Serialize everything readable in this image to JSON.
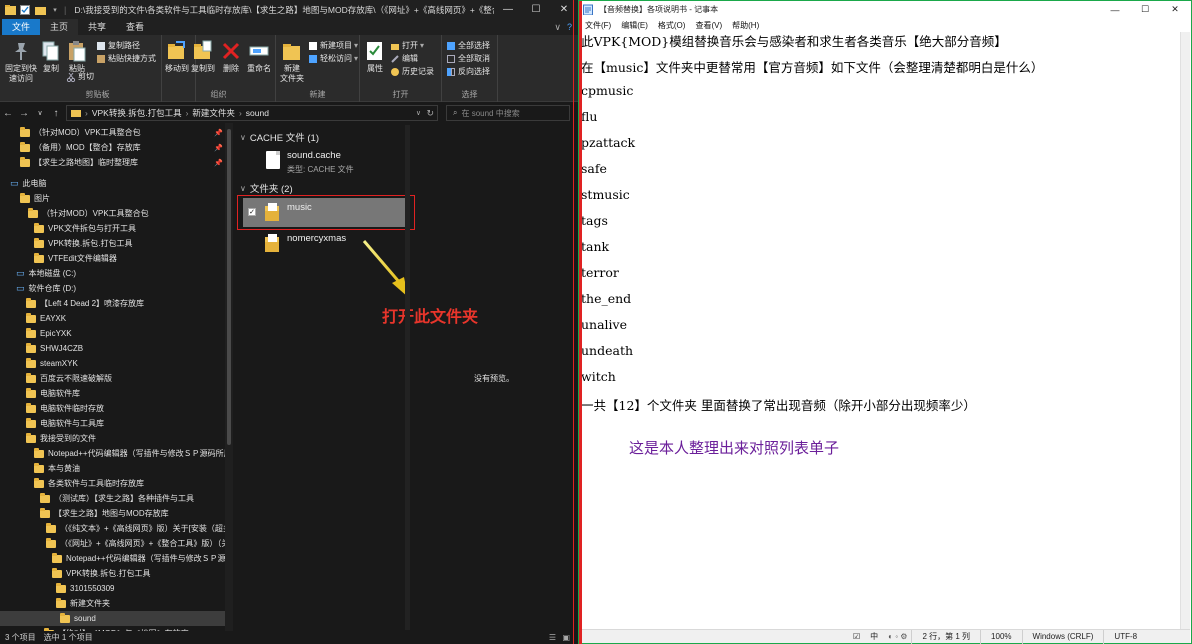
{
  "explorer": {
    "title": "D:\\我接受到的文件\\各类软件与工具临时存放库\\【求生之路】地图与MOD存放库\\（《网址》+《高线网页》+《整合工具》",
    "window_buttons": [
      "—",
      "☐",
      "✕"
    ],
    "tabs": [
      {
        "label": "文件"
      },
      {
        "label": "主页"
      },
      {
        "label": "共享"
      },
      {
        "label": "查看"
      }
    ],
    "ribbon": {
      "clipboard": {
        "group_label": "剪贴板",
        "pin_label": "固定到快\n速访问",
        "copy_label": "复制",
        "paste_label": "粘贴",
        "copy_path_label": "复制路径",
        "paste_shortcut_label": "粘贴快捷方式",
        "cut_label": "剪切"
      },
      "organize": {
        "group_label": "组织",
        "move_to_label": "移动到",
        "copy_to_label": "复制到",
        "delete_label": "删除",
        "rename_label": "重命名"
      },
      "new": {
        "group_label": "新建",
        "new_folder_label": "新建\n文件夹",
        "new_item_label": "新建项目",
        "easy_access_label": "轻松访问"
      },
      "open": {
        "group_label": "打开",
        "properties_label": "属性",
        "open_label": "打开",
        "edit_label": "编辑",
        "history_label": "历史记录"
      },
      "select": {
        "group_label": "选择",
        "select_all_label": "全部选择",
        "select_none_label": "全部取消",
        "invert_label": "反向选择"
      }
    },
    "address": {
      "crumbs": [
        "VPK转换.拆包.打包工具",
        "新建文件夹",
        "sound"
      ],
      "search_placeholder": "在 sound 中搜索"
    },
    "nav_items": [
      {
        "label": "（针对MOD）VPK工具整合包",
        "pinned": true
      },
      {
        "label": "（备用）MOD【整合】存放库",
        "pinned": true
      },
      {
        "label": "【求生之路地图】临时整理库",
        "pinned": true
      },
      {
        "label": "此电脑"
      },
      {
        "label": "图片"
      },
      {
        "label": "（针对MOD）VPK工具整合包"
      },
      {
        "label": "VPK文件拆包与打开工具"
      },
      {
        "label": "VPK转换.拆包.打包工具"
      },
      {
        "label": "VTFEdit文件编辑器"
      },
      {
        "label": "本地磁盘 (C:)"
      },
      {
        "label": "软件仓库 (D:)"
      },
      {
        "label": "【Left 4 Dead 2】喷漆存放库"
      },
      {
        "label": "EAYXK"
      },
      {
        "label": "EpicYXK"
      },
      {
        "label": "SHWJ4CZB"
      },
      {
        "label": "steamXYK"
      },
      {
        "label": "百度云不限速破解版"
      },
      {
        "label": "电脑软件库"
      },
      {
        "label": "电脑软件临时存放"
      },
      {
        "label": "电脑软件与工具库"
      },
      {
        "label": "我接受到的文件"
      },
      {
        "label": "Notepad++代码编辑器（写插件与修改ＳＰ源码所用）"
      },
      {
        "label": "本与黄油"
      },
      {
        "label": "各类软件与工具临时存放库"
      },
      {
        "label": "（测试库）【求生之路】各种插件与工具"
      },
      {
        "label": "【求生之路】地图与MOD存放库"
      },
      {
        "label": "（《纯文本》+《高线网页》版）关于[安装（超多"
      },
      {
        "label": "（《网址》+《高线网页》+《整合工具》版）（关"
      },
      {
        "label": "Notepad++代码编辑器（写插件与修改ＳＰ源码"
      },
      {
        "label": "VPK转换.拆包.打包工具"
      },
      {
        "label": "3101550309"
      },
      {
        "label": "新建文件夹"
      },
      {
        "label": "sound"
      },
      {
        "label": "【绝对】＜MOD＞与＜地图＞存放库"
      }
    ],
    "groups": {
      "cache": {
        "header": "CACHE 文件 (1)",
        "file_name": "sound.cache",
        "file_type": "类型: CACHE 文件"
      },
      "folders": {
        "header": "文件夹 (2)",
        "items": [
          "music",
          "nomercyxmas"
        ]
      }
    },
    "no_preview": "没有预览。",
    "annotation": "打开此文件夹",
    "status": {
      "count": "3 个项目",
      "selected": "选中 1 个项目"
    }
  },
  "notepad": {
    "title": "【音频替换】各项说明书 - 记事本",
    "window_buttons": [
      "—",
      "☐",
      "✕"
    ],
    "menu": [
      "文件(F)",
      "编辑(E)",
      "格式(O)",
      "查看(V)",
      "帮助(H)"
    ],
    "lines": [
      "此VPK{MOD}模组替换音乐会与感染者和求生者各类音乐【绝大部分音频】",
      "在【music】文件夹中更替常用【官方音频】如下文件（会整理清楚都明白是什么）",
      "cpmusic",
      "flu",
      "pzattack",
      "safe",
      "stmusic",
      "tags",
      "tank",
      "terror",
      "the_end",
      "unalive",
      "undeath",
      "witch",
      "一共【12】个文件夹 里面替换了常出现音频（除开小部分出现频率少）"
    ],
    "annotation": "这是本人整理出来对照列表单子",
    "status": {
      "ime": "中",
      "position": "2 行，第 1 列",
      "zoom": "100%",
      "line_ending": "Windows (CRLF)",
      "encoding": "UTF-8"
    }
  },
  "colors": {
    "explorer_bg": "#191919",
    "ribbon_bg": "#2b2b2b",
    "file_tab": "#1979ca",
    "highlight_red": "#e02222",
    "annotation_purple": "#6b1f9a",
    "notepad_border": "#1aa84a",
    "folder": "#f0c453"
  }
}
